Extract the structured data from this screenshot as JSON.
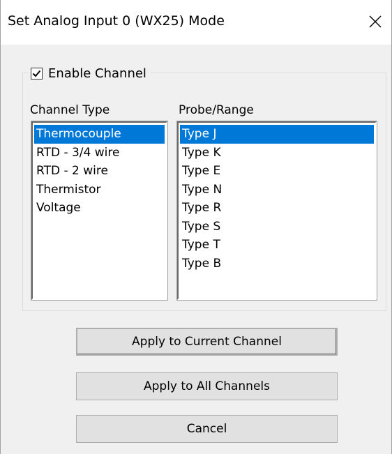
{
  "window": {
    "title": "Set Analog Input 0 (WX25) Mode",
    "close_icon": "close-x-icon"
  },
  "group": {
    "enable_label": "Enable Channel",
    "enable_checked": true
  },
  "channel_type": {
    "label": "Channel Type",
    "items": [
      "Thermocouple",
      "RTD - 3/4 wire",
      "RTD - 2 wire",
      "Thermistor",
      "Voltage"
    ],
    "selected": "Thermocouple"
  },
  "probe_range": {
    "label": "Probe/Range",
    "items": [
      "Type J",
      "Type K",
      "Type E",
      "Type N",
      "Type R",
      "Type S",
      "Type T",
      "Type B"
    ],
    "selected": "Type J"
  },
  "buttons": {
    "apply_current": "Apply to Current Channel",
    "apply_all": "Apply to All Channels",
    "cancel": "Cancel"
  },
  "colors": {
    "selection": "#0078d7",
    "dialog_bg": "#f0f0f0",
    "button_bg": "#e1e1e1"
  }
}
